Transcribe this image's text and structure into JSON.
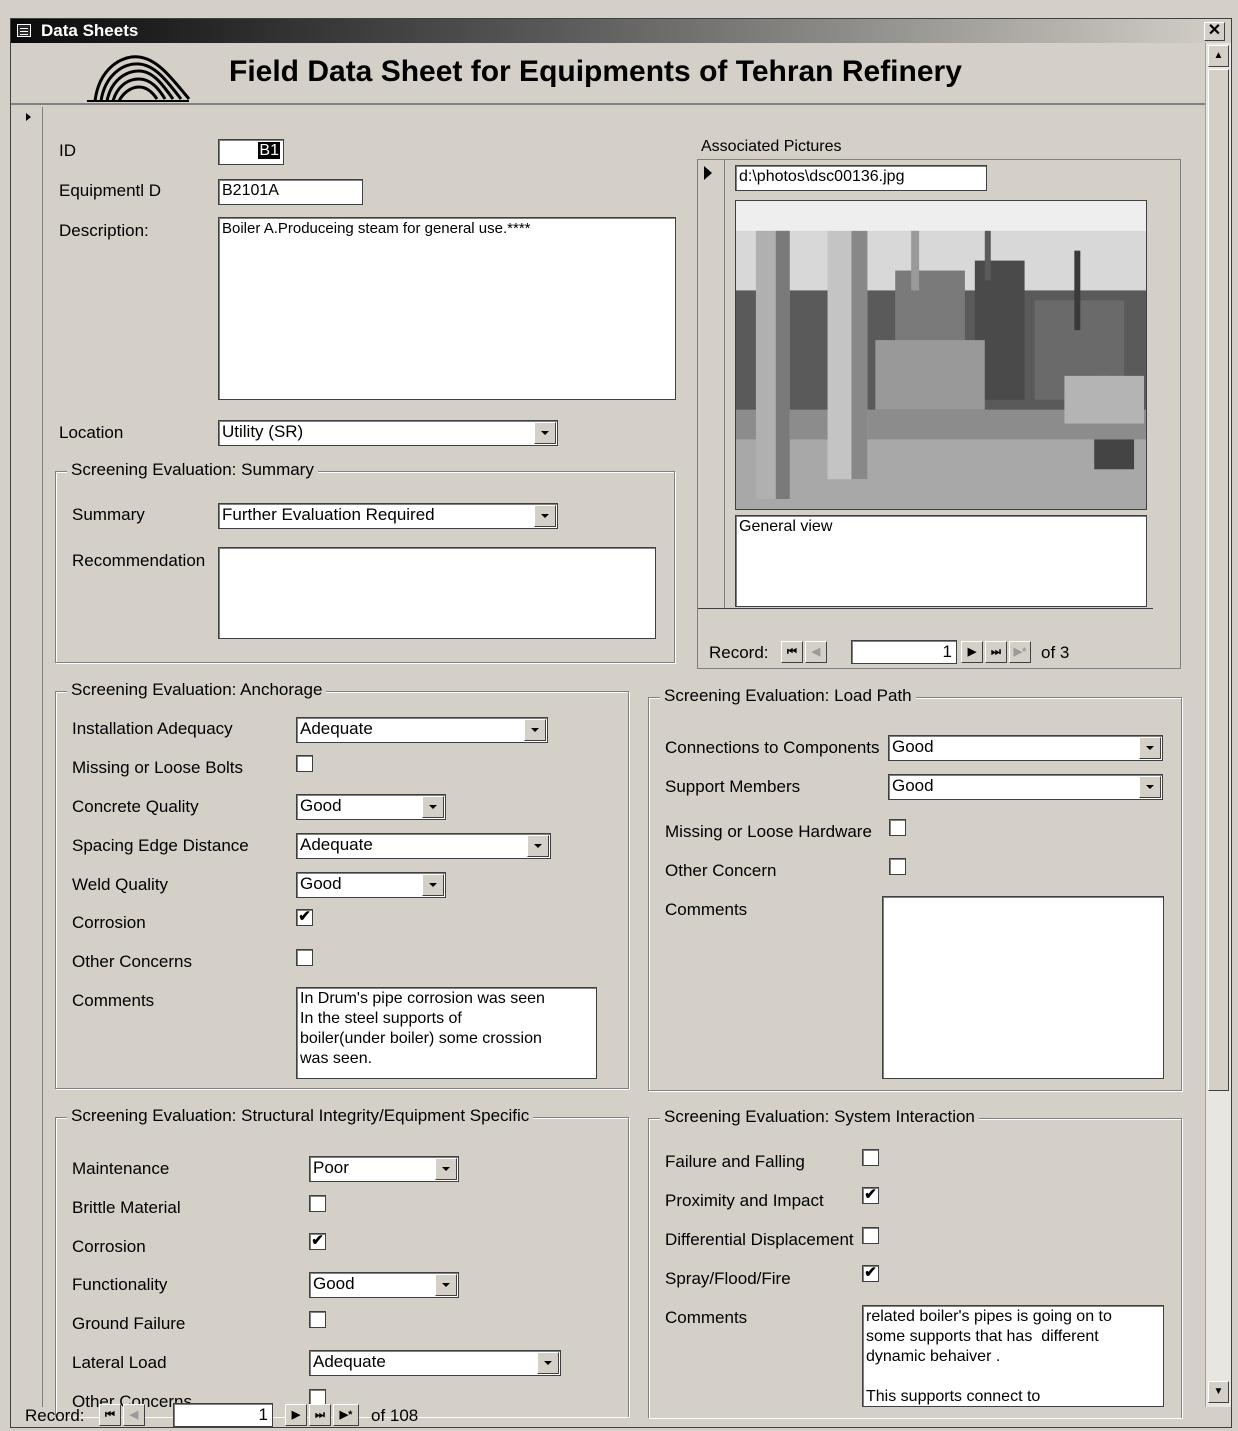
{
  "window": {
    "title": "Data Sheets",
    "close_label": "✕"
  },
  "header": {
    "title": "Field Data Sheet for Equipments of Tehran Refinery"
  },
  "main": {
    "id_label": "ID",
    "id_value": "B1",
    "equipment_id_label": "Equipmentl D",
    "equipment_id_value": "B2101A",
    "description_label": "Description:",
    "description_value": "Boiler A.Produceing steam for general use.****",
    "location_label": "Location",
    "location_value": "Utility (SR)"
  },
  "summary_group": {
    "title": "Screening Evaluation: Summary",
    "summary_label": "Summary",
    "summary_value": "Further Evaluation Required",
    "recommendation_label": "Recommendation",
    "recommendation_value": ""
  },
  "pictures": {
    "label": "Associated Pictures",
    "path": "d:\\photos\\dsc00136.jpg",
    "caption": "General view",
    "record_label": "Record:",
    "current": "1",
    "of_label": "of 3"
  },
  "anchorage": {
    "title": "Screening Evaluation: Anchorage",
    "installation_adequacy_label": "Installation Adequacy",
    "installation_adequacy_value": "Adequate",
    "missing_bolts_label": "Missing or Loose Bolts",
    "missing_bolts_checked": false,
    "concrete_quality_label": "Concrete Quality",
    "concrete_quality_value": "Good",
    "spacing_edge_label": "Spacing Edge Distance",
    "spacing_edge_value": "Adequate",
    "weld_quality_label": "Weld Quality",
    "weld_quality_value": "Good",
    "corrosion_label": "Corrosion",
    "corrosion_checked": true,
    "other_concerns_label": "Other Concerns",
    "other_concerns_checked": false,
    "comments_label": "Comments",
    "comments_value": "In Drum's pipe corrosion was seen\nIn the steel supports of\nboiler(under boiler) some crossion\nwas seen."
  },
  "load_path": {
    "title": "Screening Evaluation: Load Path",
    "connections_label": "Connections to Components",
    "connections_value": "Good",
    "support_members_label": "Support Members",
    "support_members_value": "Good",
    "missing_hardware_label": "Missing or Loose Hardware",
    "missing_hardware_checked": false,
    "other_concern_label": "Other Concern",
    "other_concern_checked": false,
    "comments_label": "Comments",
    "comments_value": ""
  },
  "structural": {
    "title": "Screening Evaluation: Structural Integrity/Equipment Specific",
    "maintenance_label": "Maintenance",
    "maintenance_value": "Poor",
    "brittle_label": "Brittle Material",
    "brittle_checked": false,
    "corrosion_label": "Corrosion",
    "corrosion_checked": true,
    "functionality_label": "Functionality",
    "functionality_value": "Good",
    "ground_failure_label": "Ground Failure",
    "ground_failure_checked": false,
    "lateral_load_label": "Lateral Load",
    "lateral_load_value": "Adequate",
    "other_concerns_label": "Other Concerns",
    "other_concerns_checked": false
  },
  "system_interaction": {
    "title": "Screening Evaluation: System Interaction",
    "failure_falling_label": "Failure and Falling",
    "failure_falling_checked": false,
    "proximity_label": "Proximity and Impact",
    "proximity_checked": true,
    "differential_label": "Differential Displacement",
    "differential_checked": false,
    "spray_label": "Spray/Flood/Fire",
    "spray_checked": true,
    "comments_label": "Comments",
    "comments_value": "related boiler's pipes is going on to\nsome supports that has  different\ndynamic behaiver .\n\nThis supports connect to"
  },
  "record_nav": {
    "record_label": "Record:",
    "current": "1",
    "of_label": "of 108"
  },
  "icons": {
    "first": "⏮",
    "prev": "◀",
    "next": "▶",
    "last": "⏭",
    "new": "▶*",
    "scroll_up": "▲",
    "scroll_down": "▼",
    "check": "✔"
  }
}
